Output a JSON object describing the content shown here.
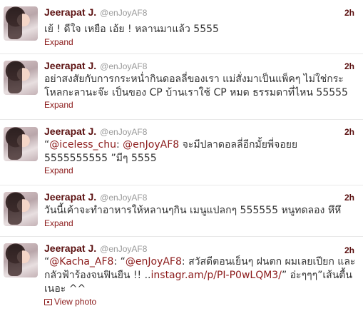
{
  "tweets": [
    {
      "fullname": "Jeerapat J.",
      "username": "@enJoyAF8",
      "time": "2h",
      "text": "เย้ ! ดีใจ เหยือ เอ้ย ! หลานมาแล้ว 5555",
      "action": "Expand"
    },
    {
      "fullname": "Jeerapat J.",
      "username": "@enJoyAF8",
      "time": "2h",
      "text": "อย่าสงสัยกับการกระหน่ำกินดอลลี่ของเรา แม่สั่งมาเป็นแพ็คๆ ไม่ใช่กระโหลกะลานะจ๊ะ เป็นของ CP บ้านเราใช้ CP หมด ธรรมดาที่ไหน 55555",
      "action": "Expand"
    },
    {
      "fullname": "Jeerapat J.",
      "username": "@enJoyAF8",
      "time": "2h",
      "quote_open": "“",
      "mention1": "@iceless_chu",
      "sep1": ": ",
      "mention2": "@enJoyAF8",
      "rest": " จะมีปลาดอลลี่อีกมั้ยพี่จอยย 5555555555 ”มีๆ 5555",
      "action": "Expand"
    },
    {
      "fullname": "Jeerapat J.",
      "username": "@enJoyAF8",
      "time": "2h",
      "text": "วันนี้เค้าจะทำอาหารให้หลานๆกิน เมนูแปลกๆ 555555 หนูทดลอง หึหึ",
      "action": "Expand"
    },
    {
      "fullname": "Jeerapat J.",
      "username": "@enJoyAF8",
      "time": "2h",
      "quote_open": "“",
      "mention1": "@Kacha_AF8",
      "sep1": ": “",
      "mention2": "@enJoyAF8",
      "mid": ": สวัสดีตอนเย็นๆ ฝนตก ผมเลยเปียก และกลัวฟ้าร้องจนฟินยืน !! ..",
      "link": "instagr.am/p/PI-P0wLQM3/",
      "rest": "” อ่ะๆๆๆ”เส้นตื้นเนอะ ^^",
      "action": "View photo"
    }
  ]
}
